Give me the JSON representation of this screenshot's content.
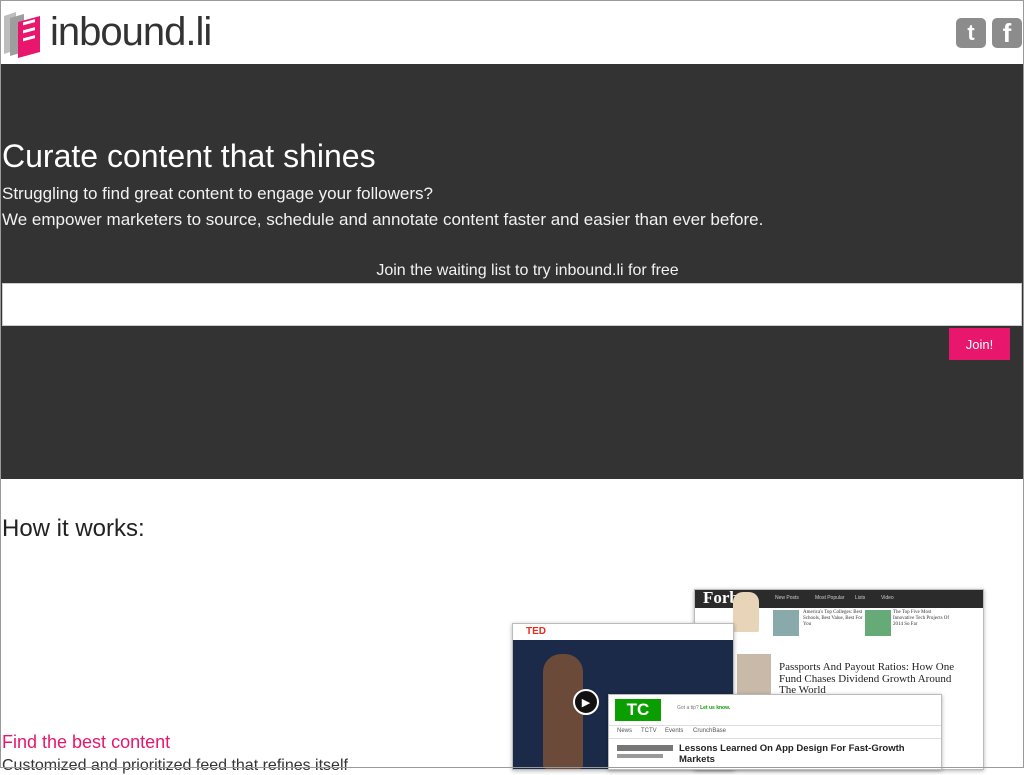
{
  "header": {
    "logo_text": "inbound.li",
    "social": {
      "twitter_glyph": "t",
      "facebook_glyph": "f"
    }
  },
  "hero": {
    "title": "Curate content that shines",
    "subtitle_1": "Struggling to find great content to engage your followers?",
    "subtitle_2": "We empower marketers to source, schedule and annotate content faster and easier than ever before.",
    "join_label": "Join the waiting list to try inbound.li for free",
    "email_value": "",
    "join_button": "Join!"
  },
  "how": {
    "title": "How it works:",
    "feature_title": "Find the best content",
    "feature_desc": "Customized and prioritized feed that refines itself"
  },
  "collage": {
    "forbes_brand": "Forbes",
    "forbes_nav": [
      "New Posts",
      "Most Popular",
      "Lists",
      "Video"
    ],
    "forbes_teaser_1": "America's Top Colleges: Best Schools, Best Value, Best For You",
    "forbes_teaser_2": "The Top Five Most Innovative Tech Projects Of 2014 So Far",
    "forbes_headline": "Passports And Payout Ratios: How One Fund Chases Dividend Growth Around The World",
    "ted_brand": "TED",
    "tc_brand": "TC",
    "tc_tip": "Got a tip?",
    "tc_tip_link": "Let us know.",
    "tc_nav": [
      "News",
      "TCTV",
      "Events",
      "CrunchBase"
    ],
    "tc_headline": "Lessons Learned On App Design For Fast-Growth Markets"
  },
  "colors": {
    "accent": "#e8166c",
    "hero_bg": "#333333",
    "tc_green": "#0a9e01"
  }
}
